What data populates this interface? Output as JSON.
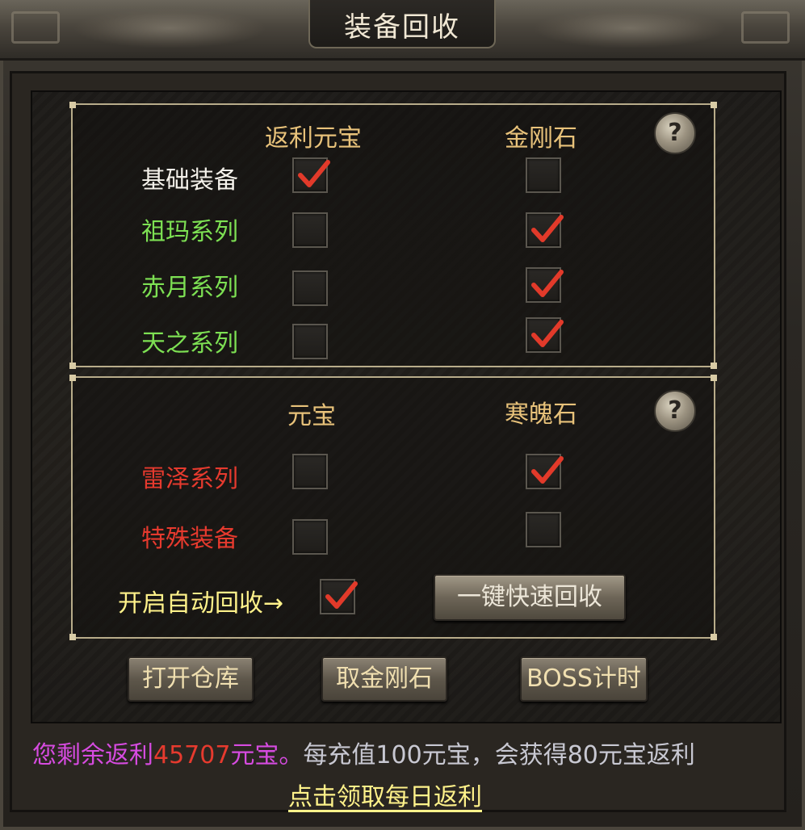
{
  "window": {
    "title": "装备回收"
  },
  "recycle_panel": {
    "col_headers": [
      "返利元宝",
      "金刚石"
    ],
    "rows": [
      {
        "label": "基础装备",
        "color": "#f4f1ea",
        "col1_checked": true,
        "col2_checked": false
      },
      {
        "label": "祖玛系列",
        "color": "#7de053",
        "col1_checked": false,
        "col2_checked": true
      },
      {
        "label": "赤月系列",
        "color": "#7de053",
        "col1_checked": false,
        "col2_checked": true
      },
      {
        "label": "天之系列",
        "color": "#7de053",
        "col1_checked": false,
        "col2_checked": true
      }
    ],
    "help_glyph": "?"
  },
  "special_panel": {
    "col_headers": [
      "元宝",
      "寒魄石"
    ],
    "rows": [
      {
        "label": "雷泽系列",
        "color": "#e63a2e",
        "col1_checked": false,
        "col2_checked": true
      },
      {
        "label": "特殊装备",
        "color": "#e63a2e",
        "col1_checked": false,
        "col2_checked": false
      }
    ],
    "auto_recycle_label": "开启自动回收→",
    "auto_recycle_checked": true,
    "quick_recycle_label": "一键快速回收",
    "help_glyph": "?"
  },
  "buttons": {
    "open_warehouse": "打开仓库",
    "take_diamond": "取金刚石",
    "boss_timer": "BOSS计时"
  },
  "footer": {
    "remaining_prefix": "您剩余返利",
    "remaining_amount": "45707",
    "remaining_unit": "元宝。",
    "recharge_info": "每充值100元宝，会获得80元宝返利",
    "daily_link": "点击领取每日返利"
  },
  "colors": {
    "header": "#e8c27a",
    "white_label": "#f4f1ea",
    "green_label": "#7de053",
    "red_label": "#e63a2e",
    "yellow_text": "#fff28a",
    "purple_text": "#d64be0",
    "amount": "#e63a2e",
    "gray_text": "#c8c8d2",
    "check_mark": "#e23a2a"
  }
}
